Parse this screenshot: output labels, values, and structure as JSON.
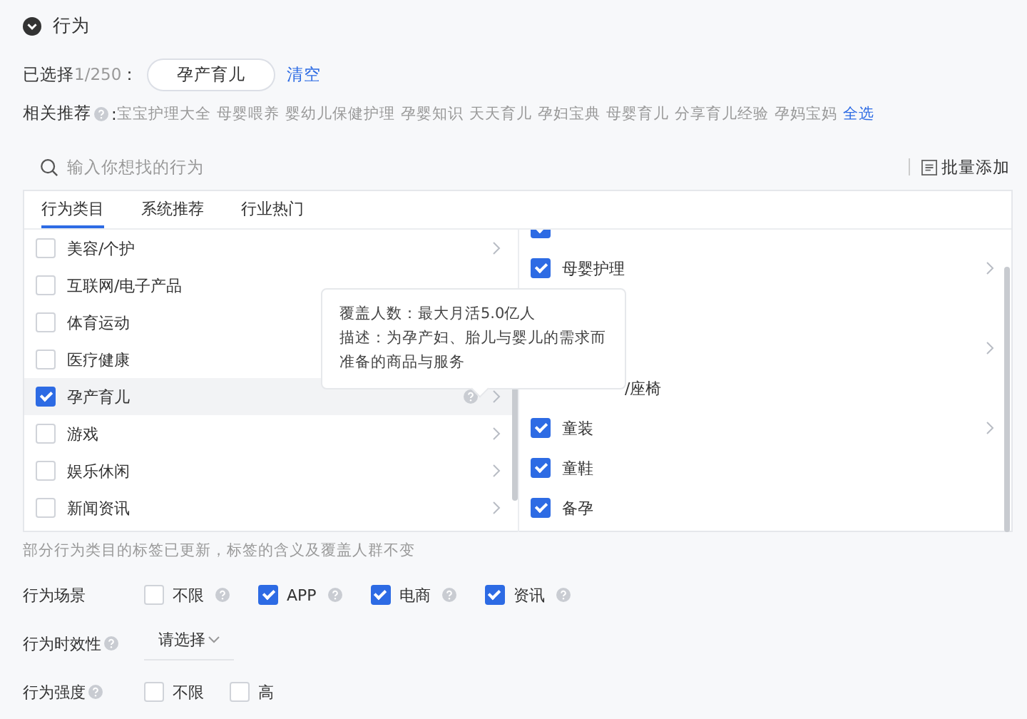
{
  "section": {
    "title": "行为",
    "expanded": true
  },
  "selected": {
    "label": "已选择",
    "count": "1/250",
    "colon": "：",
    "tags": [
      "孕产育儿"
    ],
    "clear": "清空"
  },
  "related": {
    "label": "相关推荐",
    "colon": ":",
    "items": [
      "宝宝护理大全",
      "母婴喂养",
      "婴幼儿保健护理",
      "孕婴知识",
      "天天育儿",
      "孕妇宝典",
      "母婴育儿",
      "分享育儿经验",
      "孕妈宝妈"
    ],
    "select_all": "全选"
  },
  "search": {
    "placeholder": "输入你想找的行为"
  },
  "batch_add": "批量添加",
  "tabs": [
    {
      "label": "行为类目",
      "selected": true
    },
    {
      "label": "系统推荐",
      "selected": false
    },
    {
      "label": "行业热门",
      "selected": false
    }
  ],
  "categories": [
    {
      "label": "美容/个护",
      "checked": false,
      "selected": false,
      "arrow": true,
      "help": false
    },
    {
      "label": "互联网/电子产品",
      "checked": false,
      "selected": false,
      "arrow": false,
      "help": false
    },
    {
      "label": "体育运动",
      "checked": false,
      "selected": false,
      "arrow": false,
      "help": false
    },
    {
      "label": "医疗健康",
      "checked": false,
      "selected": false,
      "arrow": false,
      "help": false
    },
    {
      "label": "孕产育儿",
      "checked": true,
      "selected": true,
      "arrow": true,
      "help": true
    },
    {
      "label": "游戏",
      "checked": false,
      "selected": false,
      "arrow": true,
      "help": false
    },
    {
      "label": "娱乐休闲",
      "checked": false,
      "selected": false,
      "arrow": true,
      "help": false
    },
    {
      "label": "新闻资讯",
      "checked": false,
      "selected": false,
      "arrow": true,
      "help": false
    }
  ],
  "subcategories": [
    {
      "kind": "cut",
      "checked": true,
      "arrow": false
    },
    {
      "kind": "item",
      "label": "母婴护理",
      "checked": true,
      "arrow": true
    },
    {
      "kind": "covered",
      "arrow": false
    },
    {
      "kind": "covered",
      "arrow": true
    },
    {
      "kind": "covered",
      "label": "/座椅",
      "arrow": false
    },
    {
      "kind": "item",
      "label": "童装",
      "checked": true,
      "arrow": true
    },
    {
      "kind": "item",
      "label": "童鞋",
      "checked": true,
      "arrow": false
    },
    {
      "kind": "item",
      "label": "备孕",
      "checked": true,
      "arrow": false
    }
  ],
  "tooltip": {
    "lines": [
      "覆盖人数：最大月活5.0亿人",
      "描述：为孕产妇、胎儿与婴儿的需求而准备的商品与服务"
    ]
  },
  "notice": "部分行为类目的标签已更新，标签的含义及覆盖人群不变",
  "scene": {
    "label": "行为场景",
    "options": [
      {
        "label": "不限",
        "checked": false
      },
      {
        "label": "APP",
        "checked": true
      },
      {
        "label": "电商",
        "checked": true
      },
      {
        "label": "资讯",
        "checked": true
      }
    ]
  },
  "timeliness": {
    "label": "行为时效性",
    "placeholder": "请选择"
  },
  "intensity": {
    "label": "行为强度",
    "options": [
      {
        "label": "不限",
        "checked": false,
        "help": false
      },
      {
        "label": "高",
        "checked": false,
        "help": false
      }
    ]
  }
}
